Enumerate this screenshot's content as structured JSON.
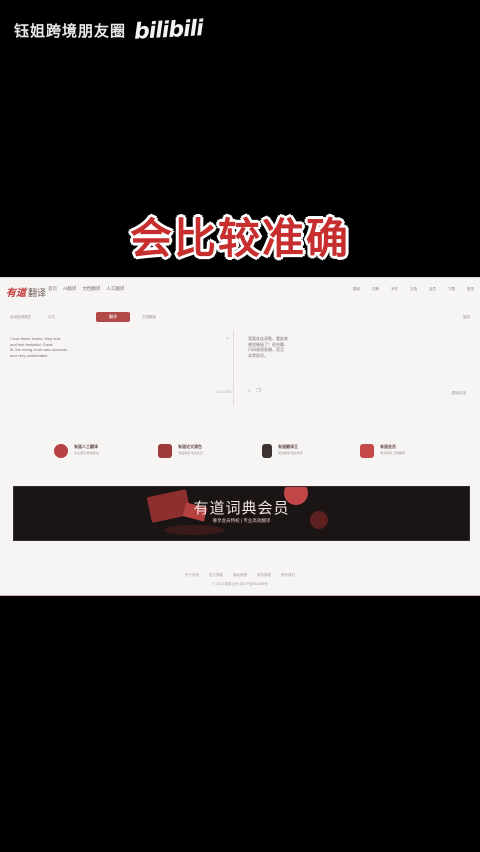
{
  "watermark": {
    "channel": "钰姐跨境朋友圈",
    "logo": "bilibili"
  },
  "caption": "会比较准确",
  "app": {
    "brand_logo": "有道",
    "brand_sub": "翻译",
    "nav": [
      "首页",
      "AI翻译",
      "文档翻译",
      "人工翻译"
    ],
    "nav_right": [
      "翻译",
      "词典",
      "写作",
      "文档",
      "会员",
      "下载",
      "登录"
    ]
  },
  "toolbar": {
    "source_lang": "自动检测语言",
    "target_lang": "中文",
    "translate_label": "翻译",
    "doc_link": "文档翻译",
    "copy_link": "复制"
  },
  "input_lines": [
    "I love these shoes, they look",
    "and feel fantastic! Great",
    "fit, the sizing chart was accurate,",
    "and very comfortable."
  ],
  "output_lines": [
    "我喜欢这双鞋，看起来",
    "感觉棒极了！很合脚，",
    "尺码表很准确，而且",
    "非常舒适。"
  ],
  "char_count": "124 / 5000",
  "feedback": "翻译反馈",
  "features": [
    {
      "title": "有道人工翻译",
      "desc": "专业译员 精准快速",
      "color": "#b84242"
    },
    {
      "title": "有道论文润色",
      "desc": "母语润色 地道表达",
      "color": "#9e3a3a"
    },
    {
      "title": "有道翻译王",
      "desc": "离线翻译 随身携带",
      "color": "#3d3232"
    },
    {
      "title": "有道会员",
      "desc": "尊享特权 无限翻译",
      "color": "#c44848"
    }
  ],
  "banner": {
    "title": "有道词典会员",
    "subtitle": "尊享会员特权 | 专业高效翻译"
  },
  "footer": {
    "links": [
      "关于有道",
      "官方博客",
      "隐私政策",
      "服务条款",
      "联系我们"
    ],
    "copyright": "© 2023 网易公司 京ICP证080268号"
  }
}
